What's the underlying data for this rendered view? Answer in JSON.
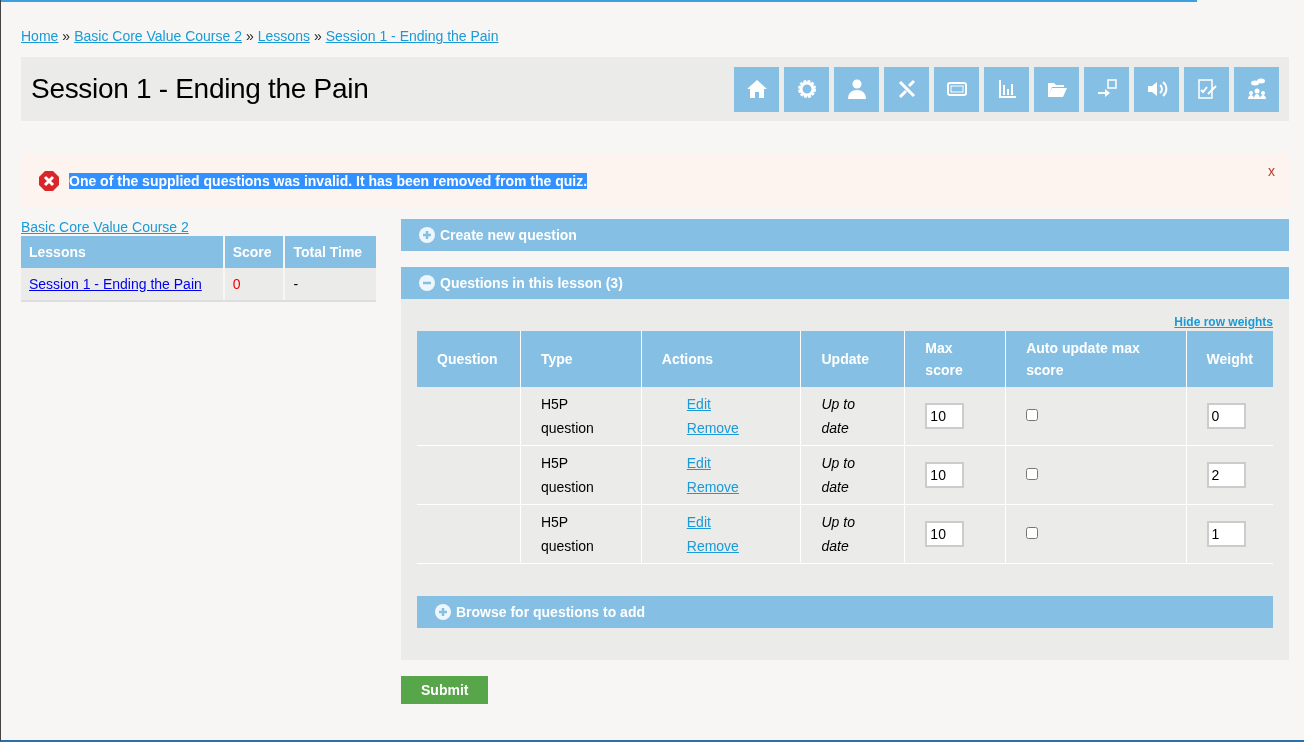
{
  "breadcrumb": [
    "Home",
    "Basic Core Value Course 2",
    "Lessons",
    "Session 1 - Ending the Pain"
  ],
  "breadcrumb_separator": "»",
  "page_title": "Session 1 - Ending the Pain",
  "alert": {
    "message": "One of the supplied questions was invalid. It has been removed from the quiz.",
    "text_selected": true,
    "close": "x"
  },
  "sidebar": {
    "course_link": "Basic Core Value Course 2",
    "columns": [
      "Lessons",
      "Score",
      "Total Time"
    ],
    "rows": [
      {
        "lesson": "Session 1 - Ending the Pain",
        "score": "0",
        "total_time": "-"
      }
    ]
  },
  "sections": [
    {
      "title": "Create new question",
      "expanded": false
    },
    {
      "title": "Questions in this lesson (3)",
      "expanded": true
    }
  ],
  "hide_weights_link": "Hide row weights",
  "table": {
    "columns": [
      "Question",
      "Type",
      "Actions",
      "Update",
      "Max score",
      "Auto update max score",
      "Weight"
    ],
    "rows": [
      {
        "question": "",
        "type": "H5P question",
        "actions": [
          "Edit",
          "Remove"
        ],
        "update": "Up to date",
        "max_score": "10",
        "auto_update": false,
        "weight": "0"
      },
      {
        "question": "",
        "type": "H5P question",
        "actions": [
          "Edit",
          "Remove"
        ],
        "update": "Up to date",
        "max_score": "10",
        "auto_update": false,
        "weight": "2"
      },
      {
        "question": "",
        "type": "H5P question",
        "actions": [
          "Edit",
          "Remove"
        ],
        "update": "Up to date",
        "max_score": "10",
        "auto_update": false,
        "weight": "1"
      }
    ]
  },
  "browse_section": {
    "title": "Browse for questions to add",
    "expanded": false
  },
  "submit": "Submit"
}
